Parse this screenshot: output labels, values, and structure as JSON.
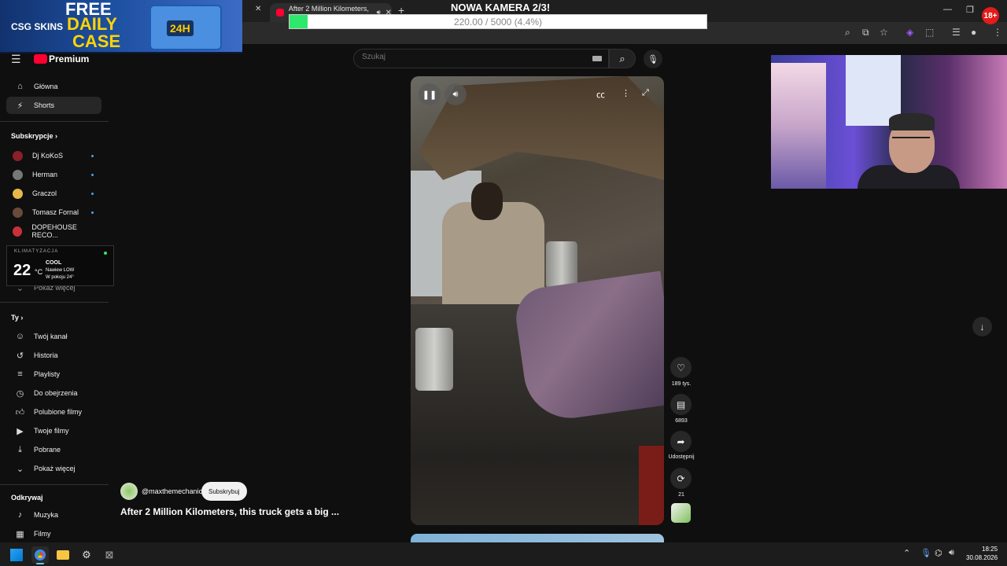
{
  "browser": {
    "active_tab_title": "After 2 Million Kilometers, t",
    "new_tab_icon": "plus-icon"
  },
  "ad": {
    "brand": "CSG SKINS",
    "line1": "FREE",
    "line2": "DAILY",
    "line3": "CASE",
    "badge": "24H"
  },
  "stream_overlay": {
    "camera_title": "NOWA KAMERA 2/3!",
    "progress_text": "220.00 / 5000 (4.4%)",
    "progress_fraction": 0.044,
    "progress_color": "#2ee86b",
    "age_badge": "18+"
  },
  "header": {
    "logo_text": "Premium",
    "search_placeholder": "Szukaj"
  },
  "sidebar": {
    "main": [
      {
        "label": "Główna",
        "icon": "home-icon"
      },
      {
        "label": "Shorts",
        "icon": "shorts-icon"
      }
    ],
    "subs_heading": "Subskrypcje",
    "subs": [
      {
        "label": "Dj KoKoS",
        "color": "#8b1f2a"
      },
      {
        "label": "Herman",
        "color": "#777777"
      },
      {
        "label": "Graczol",
        "color": "#e8b84b"
      },
      {
        "label": "Tomasz Fornal",
        "color": "#6a4a3a"
      },
      {
        "label": "DOPEHOUSE RECO...",
        "color": "#c8303a"
      }
    ],
    "show_more_partial": "Pokaż więcej",
    "you_heading": "Ty",
    "you_items": [
      {
        "label": "Twój kanał",
        "icon": "channel-icon"
      },
      {
        "label": "Historia",
        "icon": "history-icon"
      },
      {
        "label": "Playlisty",
        "icon": "playlist-icon"
      },
      {
        "label": "Do obejrzenia",
        "icon": "clock-icon"
      },
      {
        "label": "Polubione filmy",
        "icon": "like-icon"
      },
      {
        "label": "Twoje filmy",
        "icon": "video-icon"
      },
      {
        "label": "Pobrane",
        "icon": "download-icon"
      },
      {
        "label": "Pokaż więcej",
        "icon": "chevron-down-icon"
      }
    ],
    "explore_heading": "Odkrywaj",
    "explore_items": [
      {
        "label": "Muzyka",
        "icon": "music-icon"
      },
      {
        "label": "Filmy",
        "icon": "film-icon"
      }
    ]
  },
  "weather": {
    "brand": "KLIMATYZACJA",
    "temp": "22",
    "unit": "°C",
    "mode": "COOL",
    "line1": "Nawiew LOW",
    "line2": "W pokoju 24°"
  },
  "short": {
    "channel": "@maxthemechanic",
    "subscribe_label": "Subskrybuj",
    "title": "After 2 Million Kilometers, this truck gets a big ...",
    "likes": "189 tys.",
    "comments": "6893",
    "share_label": "Udostępnij",
    "remix_count": "21"
  },
  "taskbar": {
    "time": "18:25",
    "date": "30.08.2026"
  }
}
